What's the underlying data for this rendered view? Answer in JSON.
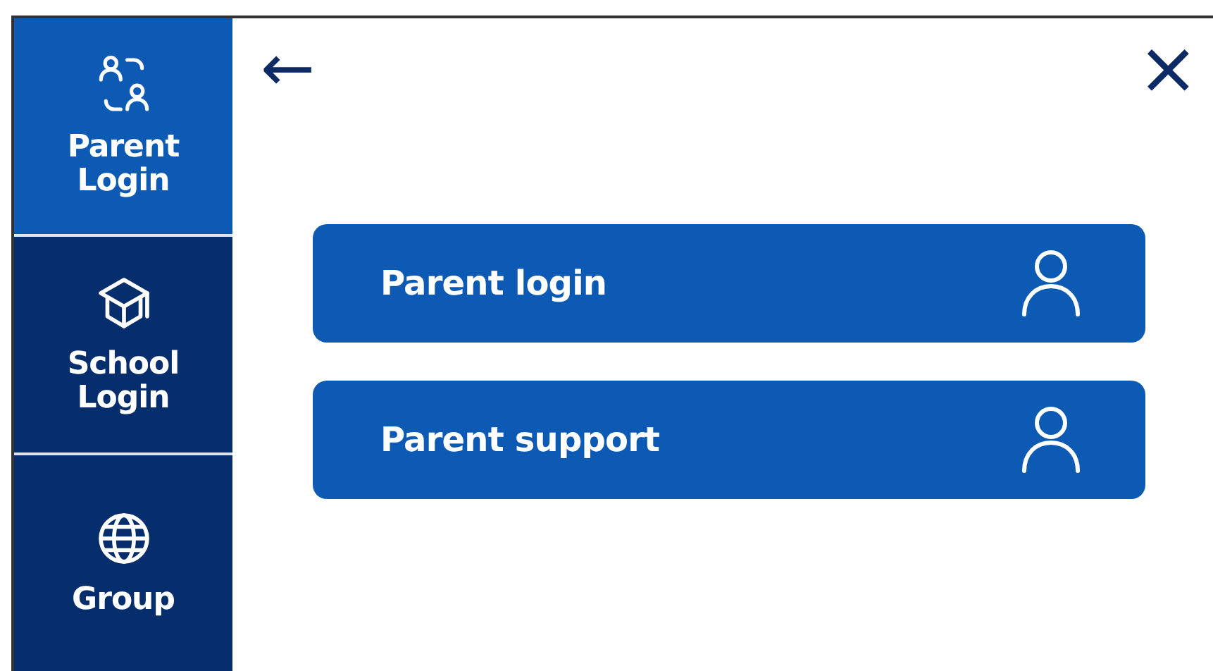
{
  "sidebar": {
    "items": [
      {
        "kind": "parents",
        "label": "Parent\nLogin",
        "selected": true
      },
      {
        "kind": "school",
        "label": "School\nLogin",
        "selected": false
      },
      {
        "kind": "globe",
        "label": "Group",
        "selected": false
      }
    ]
  },
  "header": {
    "back": "←",
    "close": "×"
  },
  "options": [
    {
      "label": "Parent login"
    },
    {
      "label": "Parent support"
    }
  ]
}
